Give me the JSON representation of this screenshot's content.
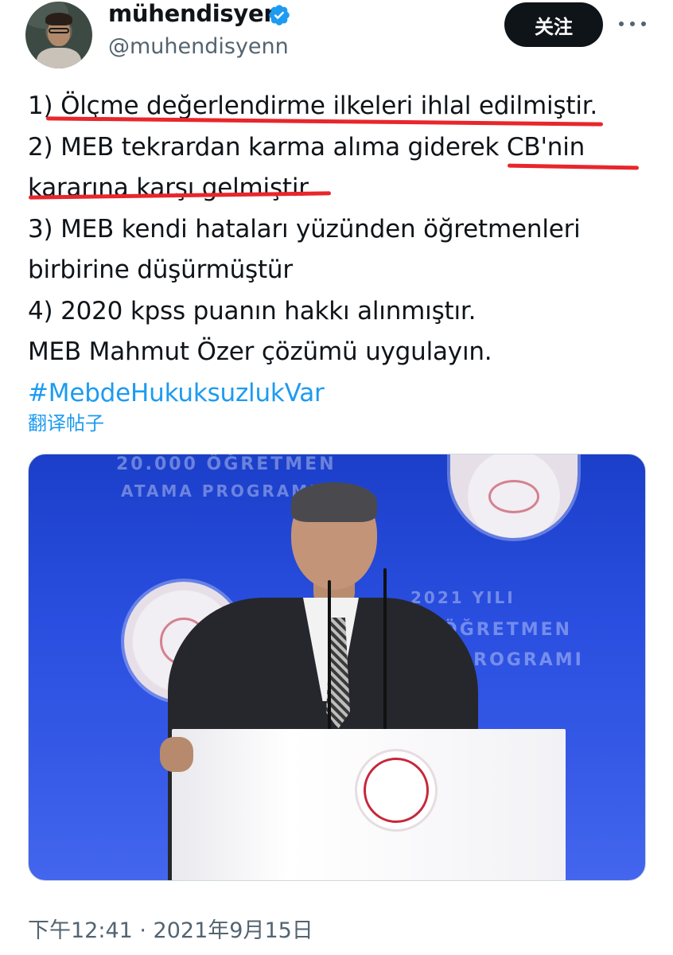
{
  "author": {
    "display_name": "mühendisyen",
    "handle": "@muhendisyenn"
  },
  "header": {
    "follow_label": "关注"
  },
  "tweet": {
    "lines": [
      "1) Ölçme değerlendirme ilkeleri ihlal edilmiştir.",
      "2) MEB tekrardan karma alıma giderek CB'nin",
      "kararına karşı gelmiştir",
      "3) MEB kendi hataları yüzünden öğretmenleri",
      "birbirine düşürmüştür",
      "4) 2020 kpss puanın hakkı alınmıştır.",
      "MEB Mahmut Özer çözümü uygulayın."
    ],
    "hashtag": "#MebdeHukuksuzlukVar",
    "translate_label": "翻译帖子"
  },
  "image": {
    "background_texts": [
      "20.000 ÖĞRETMEN",
      "ATAMA PROGRAMI",
      "2021 YILI",
      "ÖĞRETMEN",
      "PROGRAMI"
    ]
  },
  "timestamp": "下午12:41 · 2021年9月15日",
  "colors": {
    "link": "#1d9bf0",
    "secondary_text": "#536471",
    "underline_mark": "#e8262b",
    "follow_button_bg": "#0f1419"
  }
}
